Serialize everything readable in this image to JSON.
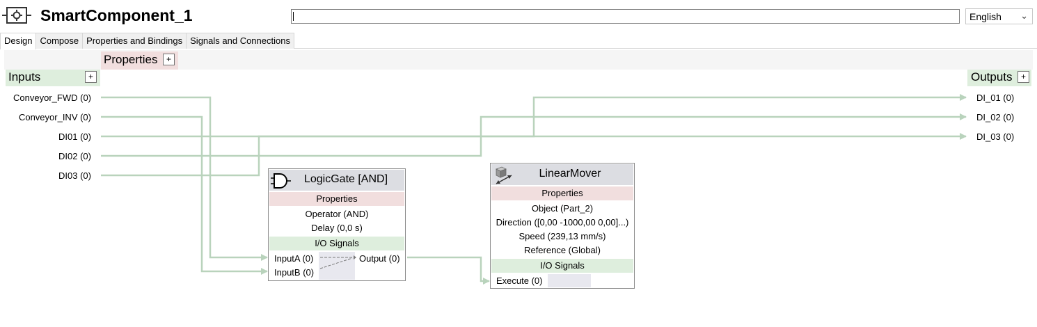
{
  "header": {
    "title": "SmartComponent_1",
    "component_icon": "smart-component-icon",
    "search_value": "",
    "language": "English"
  },
  "tabs": [
    "Design",
    "Compose",
    "Properties and Bindings",
    "Signals and Connections"
  ],
  "canvas": {
    "properties_label": "Properties",
    "inputs_label": "Inputs",
    "outputs_label": "Outputs",
    "add_symbol": "+",
    "inputs": [
      "Conveyor_FWD (0)",
      "Conveyor_INV (0)",
      "DI01 (0)",
      "DI02 (0)",
      "DI03 (0)"
    ],
    "outputs": [
      "DI_01 (0)",
      "DI_02 (0)",
      "DI_03 (0)"
    ]
  },
  "logic_gate": {
    "title": "LogicGate [AND]",
    "icon": "and-gate-icon",
    "properties_label": "Properties",
    "props": [
      "Operator (AND)",
      "Delay (0,0 s)"
    ],
    "signals_label": "I/O Signals",
    "input_a": "InputA (0)",
    "input_b": "InputB (0)",
    "output": "Output (0)"
  },
  "linear_mover": {
    "title": "LinearMover",
    "icon": "linear-mover-icon",
    "properties_label": "Properties",
    "props": [
      "Object (Part_2)",
      "Direction ([0,00 -1000,00 0,00]...)",
      "Speed (239,13 mm/s)",
      "Reference (Global)"
    ],
    "signals_label": "I/O Signals",
    "execute": "Execute (0)"
  },
  "colors": {
    "wire": "#b9d3bc",
    "pink": "#f1dede",
    "green": "#deeedd",
    "block_header": "#dcdde2"
  }
}
